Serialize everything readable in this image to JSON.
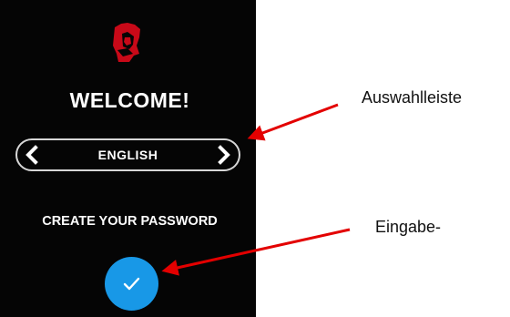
{
  "device": {
    "logo": "kingston-head-logo",
    "title": "WELCOME!",
    "language_selector": {
      "left_arrow_icon": "chevron-left-icon",
      "value": "ENGLISH",
      "right_arrow_icon": "chevron-right-icon"
    },
    "password_label": "CREATE YOUR PASSWORD",
    "confirm_button": {
      "icon": "checkmark-icon",
      "color": "#1898e7"
    }
  },
  "annotations": {
    "selector_bar_label": "Auswahlleiste",
    "input_label": "Eingabe-",
    "arrow_color": "#e30000"
  }
}
